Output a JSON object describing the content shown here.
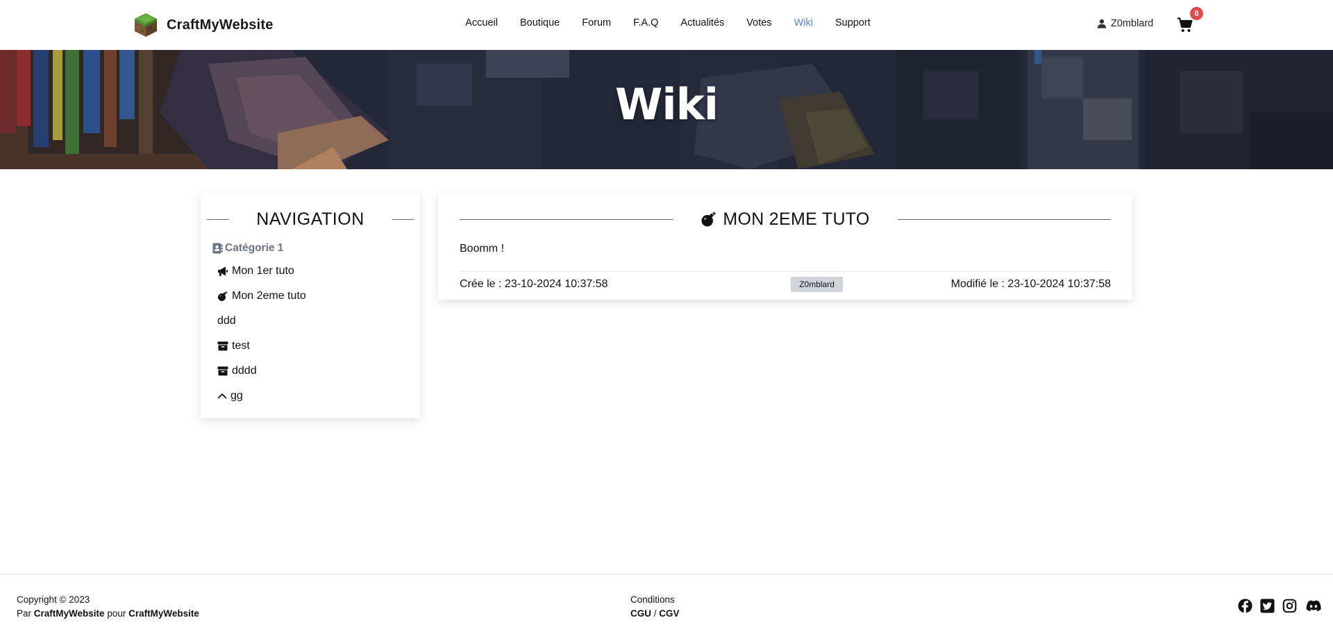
{
  "brand": {
    "name": "CraftMyWebsite"
  },
  "nav": {
    "items": [
      {
        "label": "Accueil"
      },
      {
        "label": "Boutique"
      },
      {
        "label": "Forum"
      },
      {
        "label": "F.A.Q"
      },
      {
        "label": "Actualités"
      },
      {
        "label": "Votes"
      },
      {
        "label": "Wiki"
      },
      {
        "label": "Support"
      }
    ],
    "active": "Wiki"
  },
  "user": {
    "name": "Z0mblard"
  },
  "cart": {
    "count": "0"
  },
  "banner": {
    "title": "Wiki"
  },
  "sidebar": {
    "heading": "NAVIGATION",
    "category": "Catégorie 1",
    "items": [
      {
        "label": "Mon 1er tuto",
        "icon": "bullhorn-icon"
      },
      {
        "label": "Mon 2eme tuto",
        "icon": "bomb-icon"
      },
      {
        "label": "ddd",
        "icon": ""
      },
      {
        "label": "test",
        "icon": "archive-icon"
      },
      {
        "label": "dddd",
        "icon": "archive-icon"
      },
      {
        "label": "gg",
        "icon": "chevron-up-icon"
      }
    ]
  },
  "article": {
    "title": "MON 2EME TUTO",
    "body": "Boomm !",
    "created": "Crée le : 23-10-2024 10:37:58",
    "author": "Z0mblard",
    "modified": "Modifié le : 23-10-2024 10:37:58"
  },
  "footer": {
    "copyright": "Copyright © 2023",
    "by_prefix": "Par",
    "by_name": "CraftMyWebsite",
    "for_word": "pour",
    "for_name": "CraftMyWebsite",
    "conditions": "Conditions",
    "cgu": "CGU",
    "separator": "/",
    "cgv": "CGV"
  },
  "colors": {
    "accent": "#5b7bd1",
    "badge": "#dc4b4b",
    "author_badge_bg": "#d1d5db"
  }
}
